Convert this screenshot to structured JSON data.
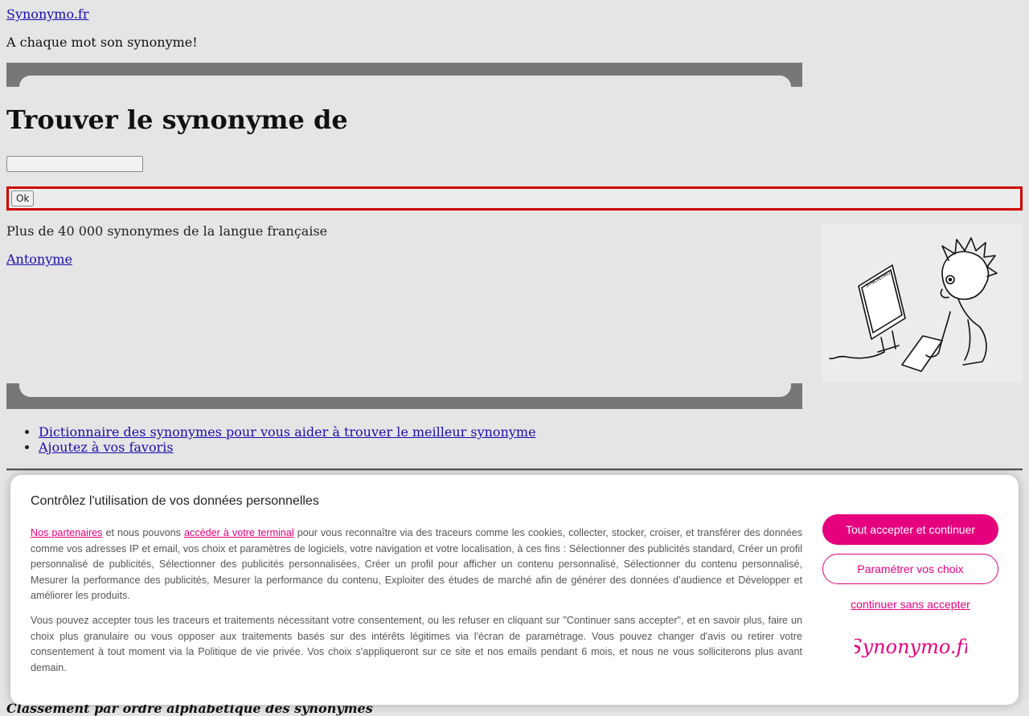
{
  "header": {
    "site_name": "Synonymo.fr",
    "tagline": "A chaque mot son synonyme!"
  },
  "search": {
    "title": "Trouver le synonyme de",
    "input_value": "",
    "submit_label": "Ok"
  },
  "main": {
    "subtitle": "Plus de 40 000 synonymes de la langue française",
    "antonyme_link": "Antonyme",
    "illustration_icon": "synonymo-cartoon-illustration"
  },
  "nav": {
    "items": [
      {
        "label": "Dictionnaire des synonymes pour vous aider à trouver le meilleur synonyme"
      },
      {
        "label": "Ajoutez à vos favoris"
      }
    ]
  },
  "below": {
    "heading": "Classement par ordre alphabétique des synonymes"
  },
  "consent": {
    "title": "Contrôlez l'utilisation de vos données personnelles",
    "link_partners": "Nos partenaires",
    "text_a": " et nous pouvons ",
    "link_terminal": "accéder à votre terminal",
    "text_b": " pour vous reconnaître via des traceurs comme les cookies, collecter, stocker, croiser, et transférer des données comme vos adresses IP et email, vos choix et paramètres de logiciels, votre navigation et votre localisation, à ces fins : Sélectionner des publicités standard, Créer un profil personnalisé de publicités, Sélectionner des publicités personnalisées, Créer un profil pour afficher un contenu personnalisé, Sélectionner du contenu personnalisé, Mesurer la performance des publicités, Mesurer la performance du contenu, Exploiter des études de marché afin de générer des données d’audience et Développer et améliorer les produits.",
    "paragraph2": "Vous pouvez accepter tous les traceurs et traitements nécessitant votre consentement, ou les refuser en cliquant sur \"Continuer sans accepter\", et en savoir plus, faire un choix plus granulaire ou vous opposer aux traitements basés sur des intérêts légitimes via l'écran de paramétrage. Vous pouvez changer d'avis ou retirer votre consentement à tout moment via la Politique de vie privée. Vos choix s'appliqueront sur ce site et nos emails pendant 6 mois, et nous ne vous solliciterons plus avant demain.",
    "accept_label": "Tout accepter et continuer",
    "params_label": "Paramétrer vos choix",
    "continue_label": "continuer sans accepter",
    "logo_text": "Synonymo.fr",
    "accent_color": "#e6007e"
  }
}
